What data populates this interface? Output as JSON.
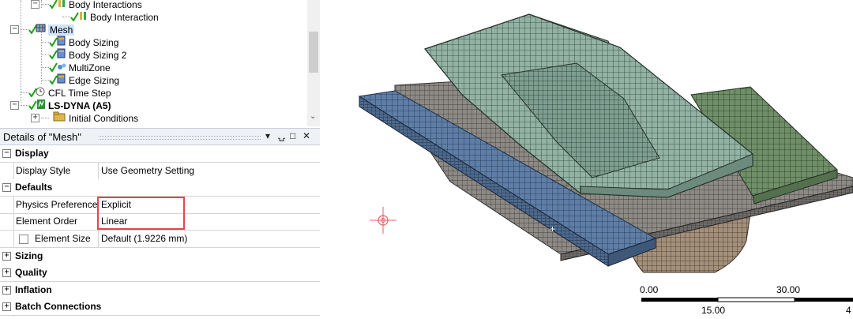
{
  "tree": {
    "items": [
      {
        "label": "Body Interactions",
        "indent": 1,
        "expander": "-",
        "icon": "body-interactions-icon",
        "bold": false
      },
      {
        "label": "Body Interaction",
        "indent": 2,
        "expander": "",
        "icon": "body-interaction-icon",
        "bold": false
      },
      {
        "label": "Mesh",
        "indent": 0,
        "expander": "-",
        "icon": "mesh-icon",
        "bold": false,
        "selected": true
      },
      {
        "label": "Body Sizing",
        "indent": 1,
        "expander": "",
        "icon": "body-sizing-icon",
        "bold": false
      },
      {
        "label": "Body Sizing 2",
        "indent": 1,
        "expander": "",
        "icon": "body-sizing-icon",
        "bold": false
      },
      {
        "label": "MultiZone",
        "indent": 1,
        "expander": "",
        "icon": "multizone-icon",
        "bold": false
      },
      {
        "label": "Edge Sizing",
        "indent": 1,
        "expander": "",
        "icon": "edge-sizing-icon",
        "bold": false
      },
      {
        "label": "CFL Time Step",
        "indent": 0,
        "expander": "",
        "icon": "cfl-time-step-icon",
        "bold": false
      },
      {
        "label": "LS-DYNA (A5)",
        "indent": 0,
        "expander": "-",
        "icon": "ls-dyna-icon",
        "bold": true
      },
      {
        "label": "Initial Conditions",
        "indent": 1,
        "expander": "+",
        "icon": "initial-conditions-icon",
        "bold": false
      }
    ]
  },
  "details": {
    "title": "Details of \"Mesh\"",
    "rows": [
      {
        "type": "category",
        "label": "Display",
        "expander": "-"
      },
      {
        "type": "prop",
        "label": "Display Style",
        "value": "Use Geometry Setting"
      },
      {
        "type": "category",
        "label": "Defaults",
        "expander": "-"
      },
      {
        "type": "prop",
        "label": "Physics Preference",
        "value": "Explicit"
      },
      {
        "type": "prop",
        "label": "Element Order",
        "value": "Linear"
      },
      {
        "type": "propcheck",
        "label": "Element Size",
        "value": "Default (1.9226 mm)"
      },
      {
        "type": "category",
        "label": "Sizing",
        "expander": "+"
      },
      {
        "type": "category",
        "label": "Quality",
        "expander": "+"
      },
      {
        "type": "category",
        "label": "Inflation",
        "expander": "+"
      },
      {
        "type": "category",
        "label": "Batch Connections",
        "expander": "+"
      }
    ]
  },
  "scale": {
    "labels_top": [
      "0.00",
      "30.00"
    ],
    "labels_bottom": [
      "15.00",
      "4"
    ]
  },
  "colors": {
    "highlight": "#e8444a",
    "mesh_blue": "#5e7ea6",
    "mesh_green": "#6f8f68",
    "mesh_teal": "#92b2a4",
    "mesh_brown": "#a48f7a"
  }
}
